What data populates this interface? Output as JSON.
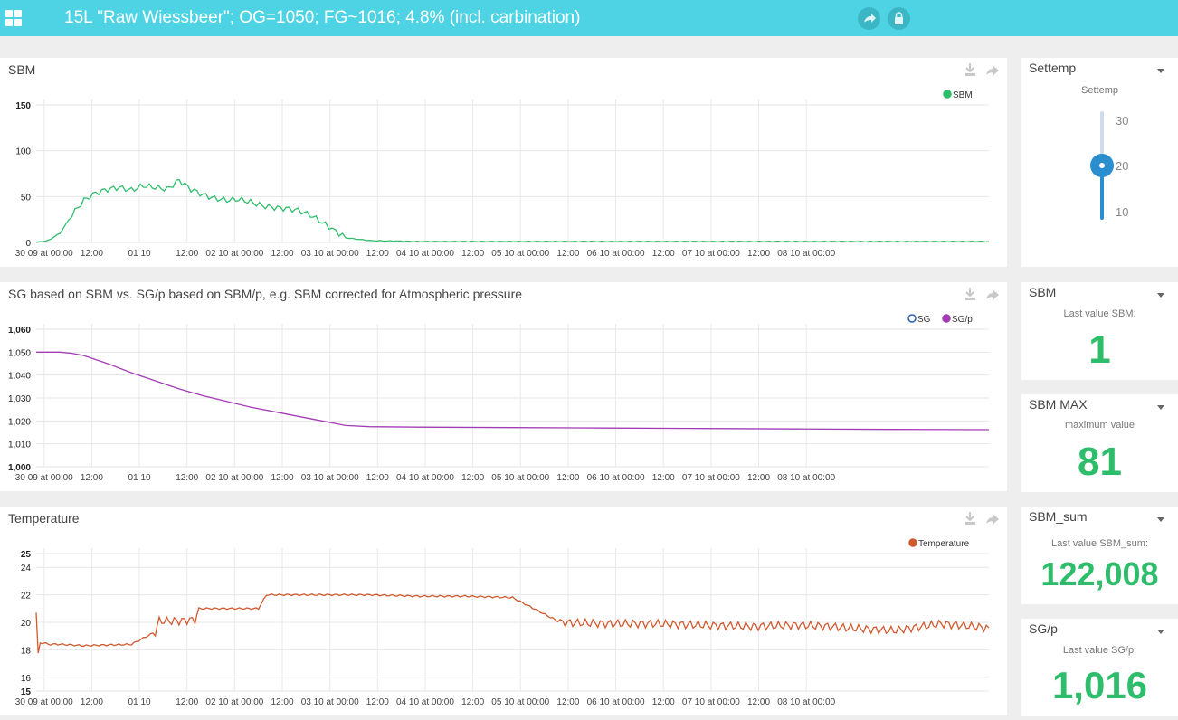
{
  "header": {
    "title": "15L \"Raw Wiessbeer\"; OG=1050; FG~1016; 4.8% (incl. carbination)",
    "menu_icon": "apps-grid-icon",
    "share_icon": "share-icon",
    "lock_icon": "lock-icon",
    "color": "#4dd3e3"
  },
  "x_ticks": [
    "30 09 at 00:00",
    "12:00",
    "01 10",
    "12:00",
    "02 10 at 00:00",
    "12:00",
    "03 10 at 00:00",
    "12:00",
    "04 10 at 00:00",
    "12:00",
    "05 10 at 00:00",
    "12:00",
    "06 10 at 00:00",
    "12:00",
    "07 10 at 00:00",
    "12:00",
    "08 10 at 00:00"
  ],
  "charts": {
    "sbm": {
      "title": "SBM",
      "legend": [
        {
          "name": "SBM",
          "color": "#2ebd6b",
          "filled": true
        }
      ],
      "y_ticks": [
        "150",
        "100",
        "50",
        "0"
      ]
    },
    "sg": {
      "title": "SG based on SBM vs. SG/p based on SBM/p, e.g. SBM corrected for Atmospheric pressure",
      "legend": [
        {
          "name": "SG",
          "color": "#2a5fb0",
          "filled": false
        },
        {
          "name": "SG/p",
          "color": "#a23cb5",
          "filled": true
        }
      ],
      "y_ticks": [
        "1,060",
        "1,050",
        "1,040",
        "1,030",
        "1,020",
        "1,010",
        "1,000"
      ]
    },
    "temp": {
      "title": "Temperature",
      "legend": [
        {
          "name": "Temperature",
          "color": "#cf5a2f",
          "filled": true
        }
      ],
      "y_ticks": [
        "25",
        "24",
        "22",
        "20",
        "18",
        "16",
        "15"
      ]
    }
  },
  "chart_data": [
    {
      "type": "line",
      "title": "SBM",
      "xlabel": "",
      "ylabel": "",
      "ylim": [
        0,
        150
      ],
      "grid": true,
      "legend_position": "top-right",
      "x": [
        0,
        3,
        6,
        9,
        12,
        15,
        18,
        21,
        24,
        27,
        30,
        33,
        36,
        39,
        42,
        45,
        48,
        51,
        54,
        57,
        60,
        63,
        66,
        69,
        72,
        78,
        84,
        96,
        108,
        120,
        144,
        168,
        192,
        216,
        240
      ],
      "series": [
        {
          "name": "SBM",
          "color": "#2ebd6b",
          "values": [
            0,
            2,
            10,
            30,
            46,
            54,
            58,
            60,
            57,
            62,
            60,
            58,
            68,
            58,
            52,
            48,
            46,
            47,
            44,
            40,
            38,
            37,
            35,
            30,
            22,
            5,
            2,
            1,
            1,
            1,
            1,
            1,
            1,
            1,
            1
          ]
        }
      ]
    },
    {
      "type": "line",
      "title": "SG based on SBM vs. SG/p based on SBM/p, e.g. SBM corrected for Atmospheric pressure",
      "xlabel": "",
      "ylabel": "",
      "ylim": [
        1000,
        1060
      ],
      "grid": true,
      "legend_position": "top-right",
      "x": [
        0,
        3,
        6,
        9,
        12,
        18,
        24,
        30,
        36,
        42,
        48,
        54,
        60,
        66,
        72,
        78,
        84,
        96,
        120,
        144,
        168,
        192,
        216,
        240
      ],
      "series": [
        {
          "name": "SG",
          "color": "#2a5fb0",
          "values": []
        },
        {
          "name": "SG/p",
          "color": "#a23cb5",
          "values": [
            1050,
            1050,
            1050,
            1049.5,
            1048.5,
            1045,
            1041,
            1037.5,
            1034,
            1031,
            1028.5,
            1026,
            1024,
            1022,
            1020,
            1018,
            1017.5,
            1017.3,
            1017.1,
            1016.9,
            1016.7,
            1016.5,
            1016.3,
            1016.2
          ]
        }
      ]
    },
    {
      "type": "line",
      "title": "Temperature",
      "xlabel": "",
      "ylabel": "",
      "ylim": [
        15,
        25
      ],
      "grid": true,
      "legend_position": "top-right",
      "x": [
        0,
        0.5,
        1,
        2,
        3,
        6,
        12,
        24,
        30,
        31,
        36,
        40,
        41,
        50,
        56,
        58,
        72,
        82,
        84,
        96,
        108,
        120,
        132,
        144,
        156,
        168,
        180,
        192,
        200,
        204,
        216,
        228,
        240
      ],
      "series": [
        {
          "name": "Temperature",
          "color": "#cf5a2f",
          "values": [
            20.7,
            17.7,
            18.5,
            18.5,
            18.4,
            18.4,
            18.3,
            18.4,
            19.3,
            20.1,
            20.1,
            20.2,
            21.0,
            21.0,
            21.0,
            22.0,
            22.0,
            22.0,
            22.0,
            21.9,
            21.9,
            21.8,
            20.0,
            19.9,
            19.9,
            19.8,
            19.7,
            19.8,
            19.7,
            19.6,
            19.4,
            19.9,
            19.6
          ]
        }
      ]
    }
  ],
  "widgets": {
    "settemp": {
      "title": "Settemp",
      "sub": "Settemp",
      "ticks": [
        "30",
        "20",
        "10"
      ],
      "value": 20,
      "range": [
        5,
        35
      ],
      "color": "#2a8ecf"
    },
    "sbm_last": {
      "title": "SBM",
      "sub": "Last value SBM:",
      "value": "1"
    },
    "sbm_max": {
      "title": "SBM MAX",
      "sub": "maximum value",
      "value": "81"
    },
    "sbm_sum": {
      "title": "SBM_sum",
      "sub": "Last value SBM_sum:",
      "value": "122,008"
    },
    "sgp": {
      "title": "SG/p",
      "sub": "Last value SG/p:",
      "value": "1,016"
    },
    "value_color": "#2ebd6b"
  },
  "panel_icons": [
    "download-icon",
    "share-icon"
  ]
}
